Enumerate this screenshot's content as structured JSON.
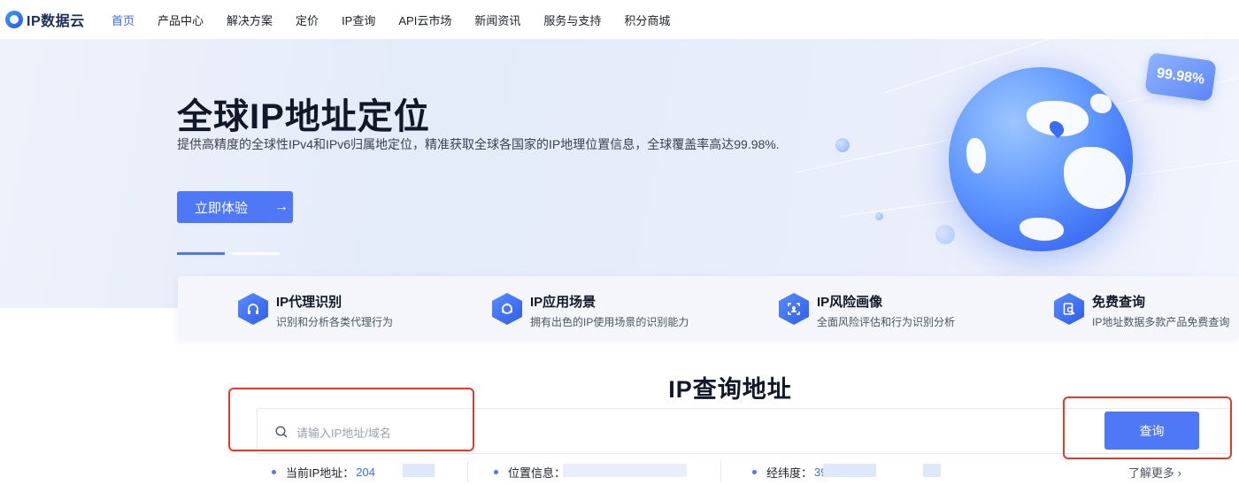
{
  "brand": {
    "logo_text": "IP数据云"
  },
  "nav": {
    "items": [
      {
        "label": "首页",
        "active": true
      },
      {
        "label": "产品中心"
      },
      {
        "label": "解决方案"
      },
      {
        "label": "定价"
      },
      {
        "label": "IP查询"
      },
      {
        "label": "API云市场"
      },
      {
        "label": "新闻资讯"
      },
      {
        "label": "服务与支持"
      },
      {
        "label": "积分商城"
      }
    ]
  },
  "hero": {
    "title": "全球IP地址定位",
    "subtitle": "提供高精度的全球性IPv4和IPv6归属地定位，精准获取全球各国家的IP地理位置信息，全球覆盖率高达99.98%.",
    "cta_label": "立即体验",
    "cta_arrow": "→",
    "badge": "99.98%"
  },
  "features": [
    {
      "title": "IP代理识别",
      "desc": "识别和分析各类代理行为",
      "icon": "proxy-icon"
    },
    {
      "title": "IP应用场景",
      "desc": "拥有出色的IP使用场景的识别能力",
      "icon": "scene-icon"
    },
    {
      "title": "IP风险画像",
      "desc": "全面风险评估和行为识别分析",
      "icon": "risk-icon"
    },
    {
      "title": "免费查询",
      "desc": "IP地址数据多款产品免费查询",
      "icon": "free-search-icon"
    }
  ],
  "query": {
    "title": "IP查询地址",
    "placeholder": "请输入IP地址/域名",
    "button_label": "查询",
    "info": [
      {
        "label": "当前IP地址：",
        "value": "204"
      },
      {
        "label": "位置信息：",
        "value": ""
      },
      {
        "label": "经纬度：",
        "value": "39."
      }
    ],
    "more_label": "了解更多 ›"
  },
  "colors": {
    "accent": "#4e78f5",
    "highlight": "#e03c2b"
  }
}
